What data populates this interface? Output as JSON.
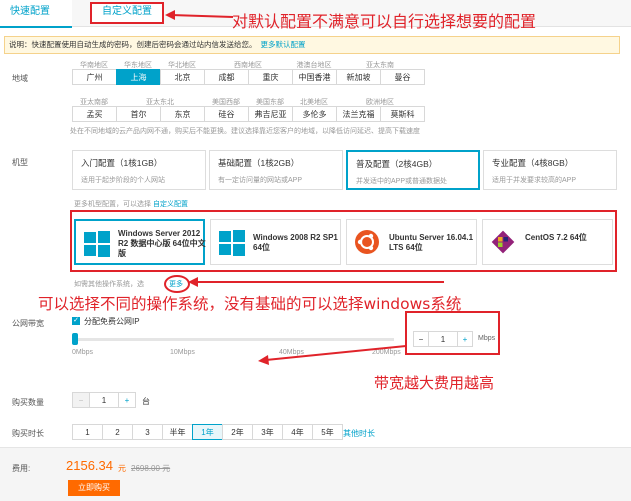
{
  "tabs": {
    "quick": "快速配置",
    "custom": "自定义配置"
  },
  "annotations": {
    "top": "对默认配置不满意可以自行选择想要的配置",
    "os": "可以选择不同的操作系统，没有基础的可以选择windows系统",
    "bandwidth": "带宽越大费用越高"
  },
  "notice": {
    "text": "说明：快速配置使用自动生成的密码，创建后密码会通过站内信发送给您。",
    "link": "更多默认配置"
  },
  "region": {
    "label": "地域",
    "groups_row1": [
      "华南地区",
      "华东地区",
      "华北地区",
      "西南地区",
      "港澳台地区",
      "亚太东南"
    ],
    "row1": [
      "广州",
      "上海",
      "北京",
      "成都",
      "重庆",
      "中国香港",
      "新加坡",
      "曼谷"
    ],
    "groups_row2": [
      "亚太南部",
      "亚太东北",
      "美国西部",
      "美国东部",
      "北美地区",
      "欧洲地区"
    ],
    "row2": [
      "孟买",
      "首尔",
      "东京",
      "硅谷",
      "弗吉尼亚",
      "多伦多",
      "法兰克福",
      "莫斯科"
    ],
    "selected": "上海",
    "hint": "处在不同地域的云产品内网不通，购买后不能更换。建议选择靠近您客户的地域，以降低访问延迟、提高下载速度"
  },
  "model": {
    "label": "机型",
    "plans": [
      {
        "title": "入门配置（1核1GB）",
        "desc": "适用于起步阶段的个人网站"
      },
      {
        "title": "基础配置（1核2GB）",
        "desc": "有一定访问量的网站或APP"
      },
      {
        "title": "普及配置（2核4GB）",
        "desc": "并发适中的APP或普通数据处"
      },
      {
        "title": "专业配置（4核8GB）",
        "desc": "适用于并发要求较高的APP"
      }
    ],
    "more_hint": "更多机型配置，可以选择",
    "more_link": "自定义配置"
  },
  "os": {
    "cards": [
      {
        "name": "Windows Server 2012 R2 数据中心版 64位中文版",
        "icon": "windows-icon"
      },
      {
        "name": "Windows 2008 R2 SP1 64位",
        "icon": "windows-icon"
      },
      {
        "name": "Ubuntu Server 16.04.1 LTS 64位",
        "icon": "ubuntu-icon"
      },
      {
        "name": "CentOS 7.2 64位",
        "icon": "centos-icon"
      }
    ],
    "more_hint": "如需其他操作系统，选",
    "more_link": "更多"
  },
  "bandwidth": {
    "label": "公网带宽",
    "checkbox": "分配免费公网IP",
    "ticks": [
      "0Mbps",
      "10Mbps",
      "40Mbps",
      "200Mbps"
    ],
    "value": "1",
    "unit": "Mbps"
  },
  "quantity": {
    "label": "购买数量",
    "value": "1",
    "unit": "台"
  },
  "duration": {
    "label": "购买时长",
    "options": [
      "1",
      "2",
      "3",
      "半年",
      "1年",
      "2年",
      "3年",
      "4年",
      "5年"
    ],
    "selected": "1年",
    "more": "其他时长"
  },
  "price": {
    "label": "费用:",
    "current": "2156.34",
    "unit": "元",
    "original": "2698.00 元"
  },
  "buy_button": "立即购买",
  "colors": {
    "accent": "#00a2ca",
    "annotation": "#e0232a",
    "price": "#ff6a00"
  }
}
